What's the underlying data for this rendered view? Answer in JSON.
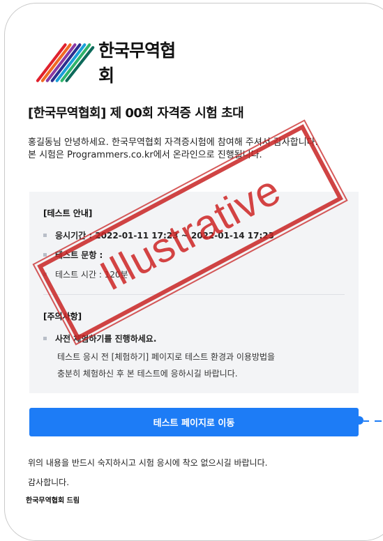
{
  "logo": {
    "text": "한국무역협회"
  },
  "title": "[한국무역협회] 제 00회 자격증 시험 초대",
  "intro": {
    "line1": "홍길동님 안녕하세요. 한국무역협회 자격증시험에 참여해 주셔서 감사합니다.",
    "line2": "본 시험은 Programmers.co.kr에서 온라인으로 진행됩니다."
  },
  "test_info": {
    "heading": "[테스트 안내]",
    "items": [
      {
        "label": "응시기간 : 2022-01-11 17:23 ~ 2022-01-14 17:23"
      },
      {
        "label": "테스트 문항 :"
      },
      {
        "label": "테스트 시간 : 120분"
      }
    ]
  },
  "notes": {
    "heading": "[주의사항]",
    "item_title": "사전 체험하기를 진행하세요.",
    "item_line1": "테스트 응시 전 [체험하기] 페이지로 테스트 환경과 이용방법을",
    "item_line2": "충분히 체험하신 후 본 테스트에 응하시길 바랍니다."
  },
  "cta": {
    "label": "테스트 페이지로 이동"
  },
  "footer": {
    "line1": "위의 내용을 반드시 숙지하시고 시험 응시에 착오 없으시길 바랍니다.",
    "line2": "감사합니다.",
    "signature": "한국무역협회 드림"
  },
  "stamp": {
    "text": "Illustrative"
  },
  "colors": {
    "accent": "#1d7cf6",
    "panel": "#f3f4f6",
    "stamp": "#cd2323"
  }
}
